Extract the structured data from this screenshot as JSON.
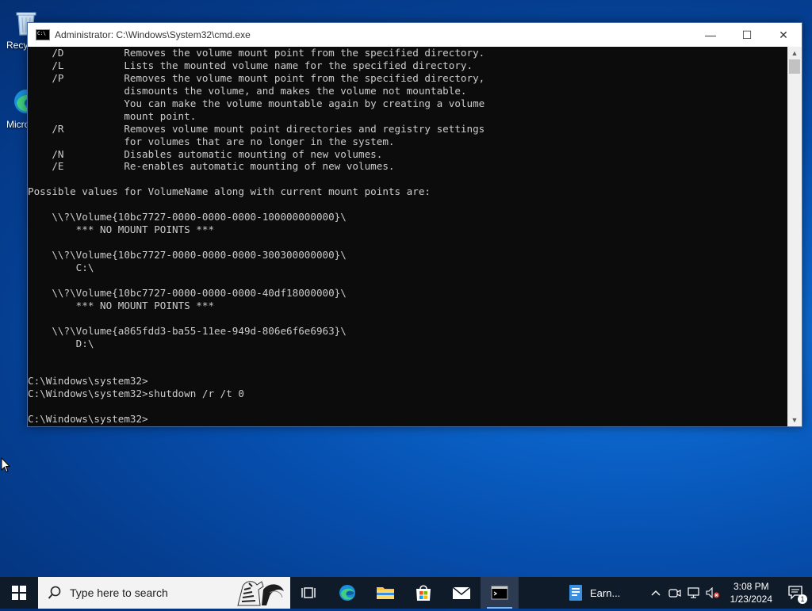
{
  "desktop": {
    "icons": [
      {
        "label": "Recycle Bin",
        "name": "recycle-bin"
      },
      {
        "label": "Microsoft Edge",
        "name": "edge"
      }
    ]
  },
  "window": {
    "title": "Administrator: C:\\Windows\\System32\\cmd.exe",
    "minimize": "—",
    "maximize": "☐",
    "close": "✕"
  },
  "console": {
    "lines": [
      "    /D          Removes the volume mount point from the specified directory.",
      "    /L          Lists the mounted volume name for the specified directory.",
      "    /P          Removes the volume mount point from the specified directory,",
      "                dismounts the volume, and makes the volume not mountable.",
      "                You can make the volume mountable again by creating a volume",
      "                mount point.",
      "    /R          Removes volume mount point directories and registry settings",
      "                for volumes that are no longer in the system.",
      "    /N          Disables automatic mounting of new volumes.",
      "    /E          Re-enables automatic mounting of new volumes.",
      "",
      "Possible values for VolumeName along with current mount points are:",
      "",
      "    \\\\?\\Volume{10bc7727-0000-0000-0000-100000000000}\\",
      "        *** NO MOUNT POINTS ***",
      "",
      "    \\\\?\\Volume{10bc7727-0000-0000-0000-300300000000}\\",
      "        C:\\",
      "",
      "    \\\\?\\Volume{10bc7727-0000-0000-0000-40df18000000}\\",
      "        *** NO MOUNT POINTS ***",
      "",
      "    \\\\?\\Volume{a865fdd3-ba55-11ee-949d-806e6f6e6963}\\",
      "        D:\\",
      "",
      "",
      "C:\\Windows\\system32>",
      "C:\\Windows\\system32>shutdown /r /t 0",
      "",
      "C:\\Windows\\system32>"
    ]
  },
  "taskbar": {
    "search_placeholder": "Type here to search",
    "pinned": [
      "task-view",
      "edge",
      "file-explorer",
      "microsoft-store",
      "mail",
      "command-prompt"
    ],
    "app_label": "Earn...",
    "clock_time": "3:08 PM",
    "clock_date": "1/23/2024",
    "notification_count": "1"
  },
  "colors": {
    "console_bg": "#0c0c0c",
    "console_fg": "#cccccc",
    "taskbar_bg": "#101b2a",
    "accent": "#7fb4ef"
  }
}
